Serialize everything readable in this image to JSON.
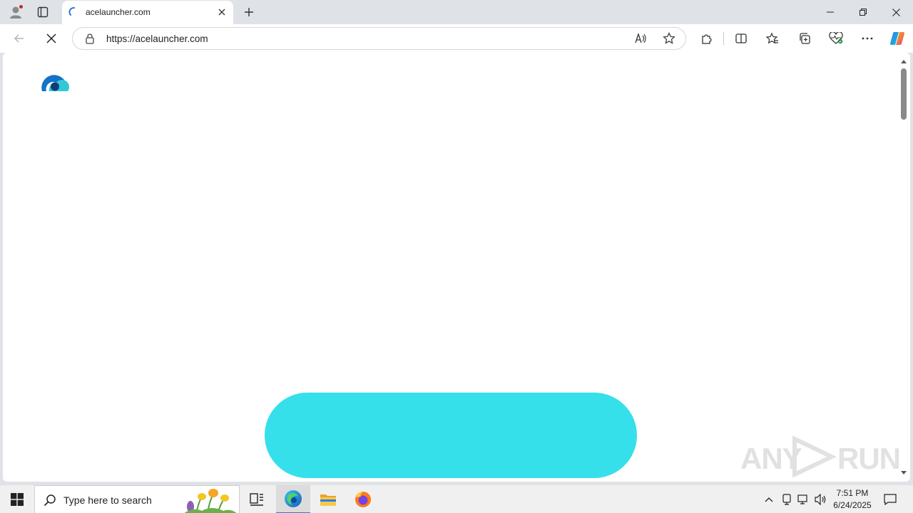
{
  "browser": {
    "tab": {
      "title": "acelauncher.com"
    },
    "address_bar": {
      "url": "https://acelauncher.com"
    }
  },
  "taskbar": {
    "search_placeholder": "Type here to search",
    "clock": {
      "time": "7:51 PM",
      "date": "6/24/2025"
    }
  },
  "page": {
    "watermark": {
      "left": "ANY",
      "right": "RUN"
    },
    "accent_color": "#35e0eb"
  },
  "icons": {
    "profile": "profile-icon",
    "tab_actions": "tab-actions-icon",
    "close": "close-icon",
    "new_tab": "plus-icon",
    "back": "back-arrow-icon",
    "stop": "stop-loading-icon",
    "read_aloud": "read-aloud-icon",
    "favorite": "star-icon",
    "extensions": "puzzle-icon",
    "split_screen": "split-screen-icon",
    "favorites": "favorites-icon",
    "collections": "collections-icon",
    "browser_essentials": "heart-pulse-icon",
    "menu": "ellipsis-icon",
    "copilot": "copilot-icon"
  }
}
